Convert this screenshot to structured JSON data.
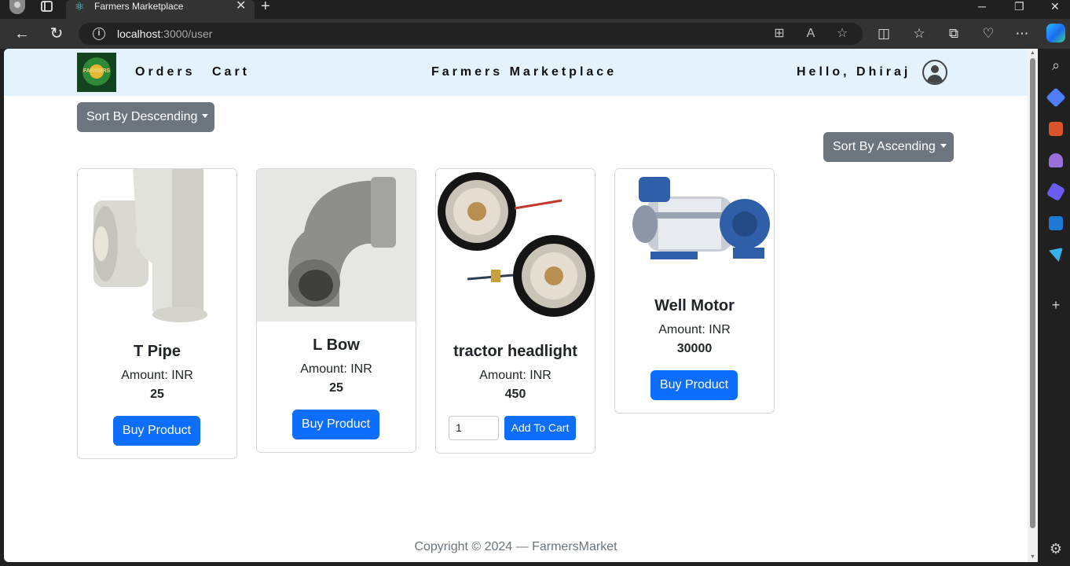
{
  "browser": {
    "tab_title": "Farmers Marketplace",
    "url_host": "localhost",
    "url_path": ":3000/user"
  },
  "navbar": {
    "links": [
      "Orders",
      "Cart"
    ],
    "brand": "Farmers Marketplace",
    "greeting": "Hello, Dhiraj",
    "logo_text": "FARMERS"
  },
  "sort": {
    "descending_label": "Sort By Descending",
    "ascending_label": "Sort By Ascending"
  },
  "products": [
    {
      "name": "T Pipe",
      "amount_label": "Amount: INR",
      "price": "25",
      "action": "Buy Product",
      "image": "pvc-tee-pipe"
    },
    {
      "name": "L Bow",
      "amount_label": "Amount: INR",
      "price": "25",
      "action": "Buy Product",
      "image": "pvc-elbow"
    },
    {
      "name": "tractor headlight",
      "amount_label": "Amount: INR",
      "price": "450",
      "quantity": "1",
      "action": "Add To Cart",
      "image": "tractor-headlights"
    },
    {
      "name": "Well Motor",
      "amount_label": "Amount: INR",
      "price": "30000",
      "action": "Buy Product",
      "image": "openwell-pump-motor"
    }
  ],
  "footer": {
    "copyright": "Copyright © 2024 — FarmersMarket"
  },
  "colors": {
    "navbar_bg": "#e3f2fd",
    "primary": "#0d6efd",
    "secondary": "#6c757d"
  }
}
